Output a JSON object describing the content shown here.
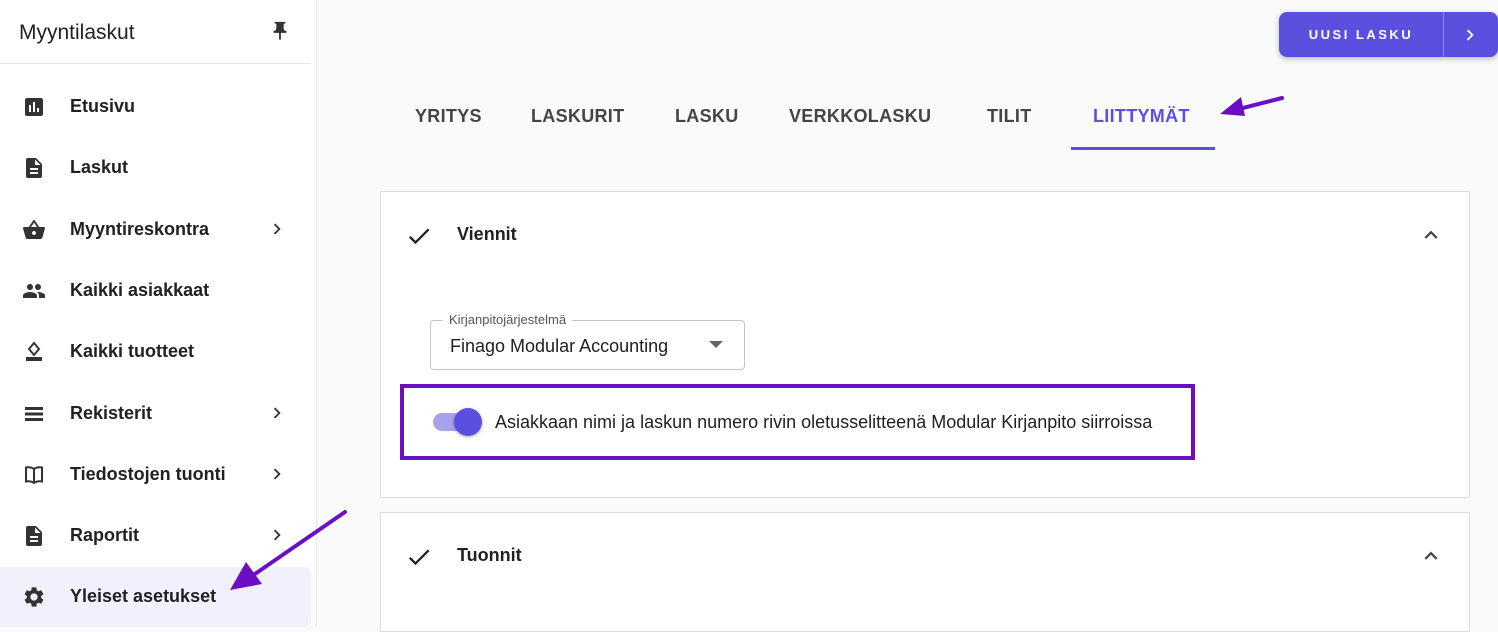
{
  "sidebar": {
    "title": "Myyntilaskut",
    "items": [
      {
        "label": "Etusivu",
        "icon": "bar-chart-icon",
        "chevron": false
      },
      {
        "label": "Laskut",
        "icon": "document-icon",
        "chevron": false
      },
      {
        "label": "Myyntireskontra",
        "icon": "basket-icon",
        "chevron": true
      },
      {
        "label": "Kaikki asiakkaat",
        "icon": "people-icon",
        "chevron": false
      },
      {
        "label": "Kaikki tuotteet",
        "icon": "stamp-icon",
        "chevron": false
      },
      {
        "label": "Rekisterit",
        "icon": "list-icon",
        "chevron": true
      },
      {
        "label": "Tiedostojen tuonti",
        "icon": "book-icon",
        "chevron": true
      },
      {
        "label": "Raportit",
        "icon": "document-icon",
        "chevron": true
      },
      {
        "label": "Yleiset asetukset",
        "icon": "gear-icon",
        "chevron": false,
        "active": true
      }
    ]
  },
  "header": {
    "new_invoice_label": "UUSI LASKU"
  },
  "tabs": [
    {
      "label": "YRITYS"
    },
    {
      "label": "LASKURIT"
    },
    {
      "label": "LASKU"
    },
    {
      "label": "VERKKOLASKU"
    },
    {
      "label": "TILIT"
    },
    {
      "label": "LIITTYMÄT",
      "active": true
    }
  ],
  "exports": {
    "title": "Viennit",
    "accounting_system_label": "Kirjanpitojärjestelmä",
    "accounting_system_value": "Finago Modular Accounting",
    "toggle_label": "Asiakkaan nimi ja laskun numero rivin oletusselitteenä Modular Kirjanpito siirroissa",
    "toggle_on": true
  },
  "imports": {
    "title": "Tuonnit"
  },
  "colors": {
    "accent": "#5b4fe0",
    "annotation": "#6a0fc4"
  }
}
